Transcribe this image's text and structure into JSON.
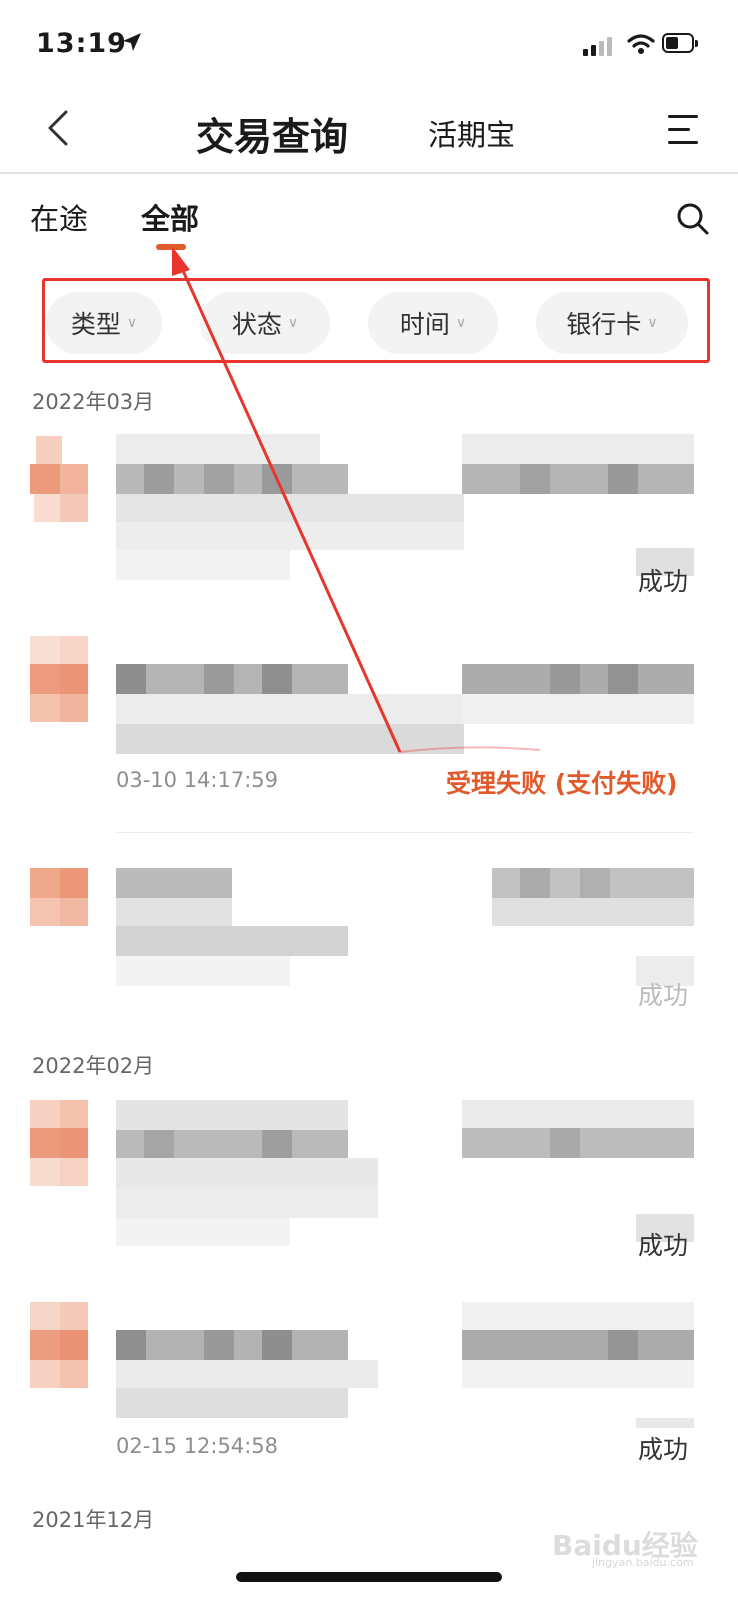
{
  "status_bar": {
    "time": "13:19"
  },
  "nav": {
    "title": "交易查询",
    "subtitle": "活期宝"
  },
  "tabs": [
    {
      "label": "在途"
    },
    {
      "label": "全部"
    }
  ],
  "filters": [
    {
      "label": "类型"
    },
    {
      "label": "状态"
    },
    {
      "label": "时间"
    },
    {
      "label": "银行卡"
    }
  ],
  "groups": [
    {
      "month": "2022年03月"
    },
    {
      "month": "2022年02月"
    },
    {
      "month": "2021年12月"
    }
  ],
  "records": [
    {
      "time": "",
      "status": "成功"
    },
    {
      "time": "03-10 14:17:59",
      "status": "受理失败 (支付失败)"
    },
    {
      "time": "",
      "status": "成功"
    },
    {
      "time": "",
      "status": "成功"
    },
    {
      "time": "02-15 12:54:58",
      "status": "成功"
    }
  ],
  "watermark": {
    "brand": "Baidu经验",
    "url": "jingyan.baidu.com"
  },
  "colors": {
    "accent": "#e05a2b",
    "annotation": "#e8352d"
  }
}
